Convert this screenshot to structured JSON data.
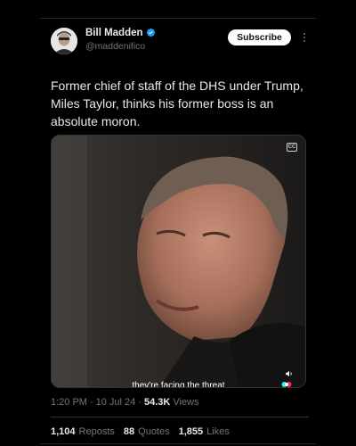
{
  "author": {
    "display_name": "Bill Madden",
    "handle": "@maddenifico",
    "verified": true
  },
  "header": {
    "subscribe_label": "Subscribe"
  },
  "tweet": {
    "text": "Former chief of staff of the DHS under Trump, Miles Taylor, thinks his former boss is an absolute moron."
  },
  "media": {
    "type": "video",
    "caption_subtitle": "they're facing the threat",
    "cc_label": "CC",
    "icons": [
      "closed-captions-icon",
      "volume-icon",
      "tiktok-watermark-icon"
    ]
  },
  "meta": {
    "time": "1:20 PM",
    "date": "10 Jul 24",
    "separator": "·",
    "views_count": "54.3K",
    "views_label": "Views"
  },
  "stats": {
    "reposts_count": "1,104",
    "reposts_label": "Reposts",
    "quotes_count": "88",
    "quotes_label": "Quotes",
    "likes_count": "1,855",
    "likes_label": "Likes"
  },
  "colors": {
    "background": "#000000",
    "text_primary": "#e7e9ea",
    "text_secondary": "#71767b",
    "verified_blue": "#1d9bf0",
    "divider": "#2f3336"
  }
}
